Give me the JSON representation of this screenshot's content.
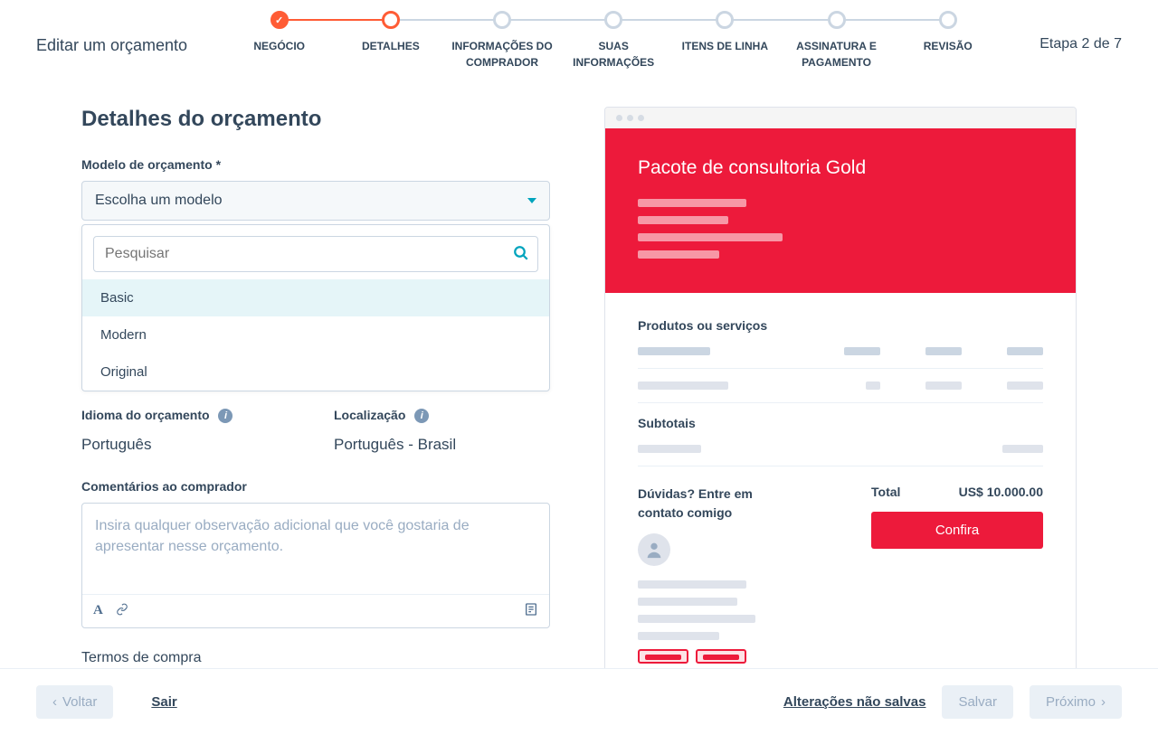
{
  "header": {
    "title": "Editar um orçamento",
    "step_counter": "Etapa 2 de 7",
    "steps": [
      {
        "label": "NEGÓCIO"
      },
      {
        "label": "DETALHES"
      },
      {
        "label": "INFORMAÇÕES DO COMPRADOR"
      },
      {
        "label": "SUAS INFORMAÇÕES"
      },
      {
        "label": "ITENS DE LINHA"
      },
      {
        "label": "ASSINATURA E PAGAMENTO"
      },
      {
        "label": "REVISÃO"
      }
    ]
  },
  "page": {
    "title": "Detalhes do orçamento"
  },
  "template": {
    "label": "Modelo de orçamento *",
    "placeholder": "Escolha um modelo",
    "search_placeholder": "Pesquisar",
    "options": [
      "Basic",
      "Modern",
      "Original"
    ]
  },
  "language": {
    "label": "Idioma do orçamento",
    "value": "Português"
  },
  "locale": {
    "label": "Localização",
    "value": "Português - Brasil"
  },
  "comments": {
    "label": "Comentários ao comprador",
    "placeholder": "Insira qualquer observação adicional que você gostaria de apresentar nesse orçamento."
  },
  "terms": {
    "label": "Termos de compra"
  },
  "preview": {
    "title": "Pacote de consultoria Gold",
    "products_label": "Produtos ou serviços",
    "subtotals_label": "Subtotais",
    "total_label": "Total",
    "total_value": "US$ 10.000.00",
    "questions": "Dúvidas? Entre em contato comigo",
    "cta": "Confira"
  },
  "footer": {
    "back": "Voltar",
    "exit": "Sair",
    "unsaved": "Alterações não salvas",
    "save": "Salvar",
    "next": "Próximo"
  }
}
